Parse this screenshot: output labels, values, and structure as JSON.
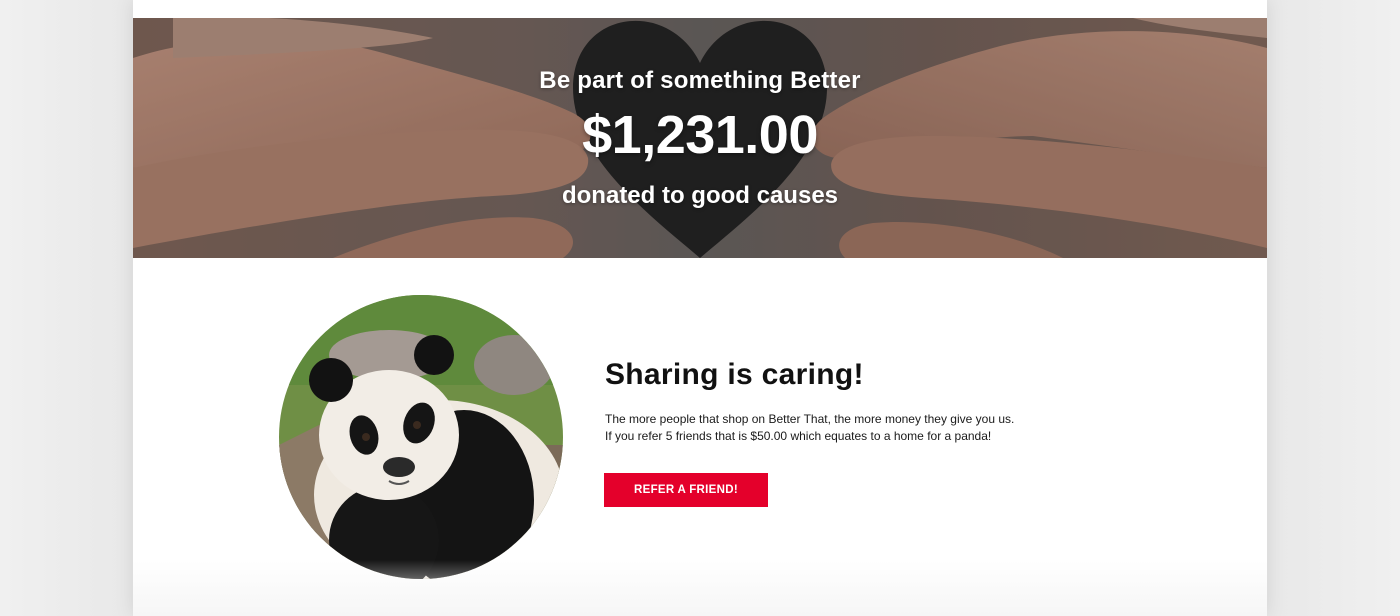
{
  "hero": {
    "kicker": "Be part of something Better",
    "amount": "$1,231.00",
    "subtitle": "donated to good causes",
    "image": "hands-holding-paper-heart"
  },
  "share": {
    "title": "Sharing is caring!",
    "line1": "The more people that shop on Better That, the more money they give you us.",
    "line2": "If you refer 5 friends that is $50.00 which equates to a home for a panda!",
    "button_label": "REFER A FRIEND!",
    "image": "giant-panda-photo"
  },
  "colors": {
    "accent": "#e4002b",
    "heading": "#111111",
    "hero_text": "#ffffff",
    "page_bg": "#ffffff",
    "outer_bg": "#ececec"
  }
}
